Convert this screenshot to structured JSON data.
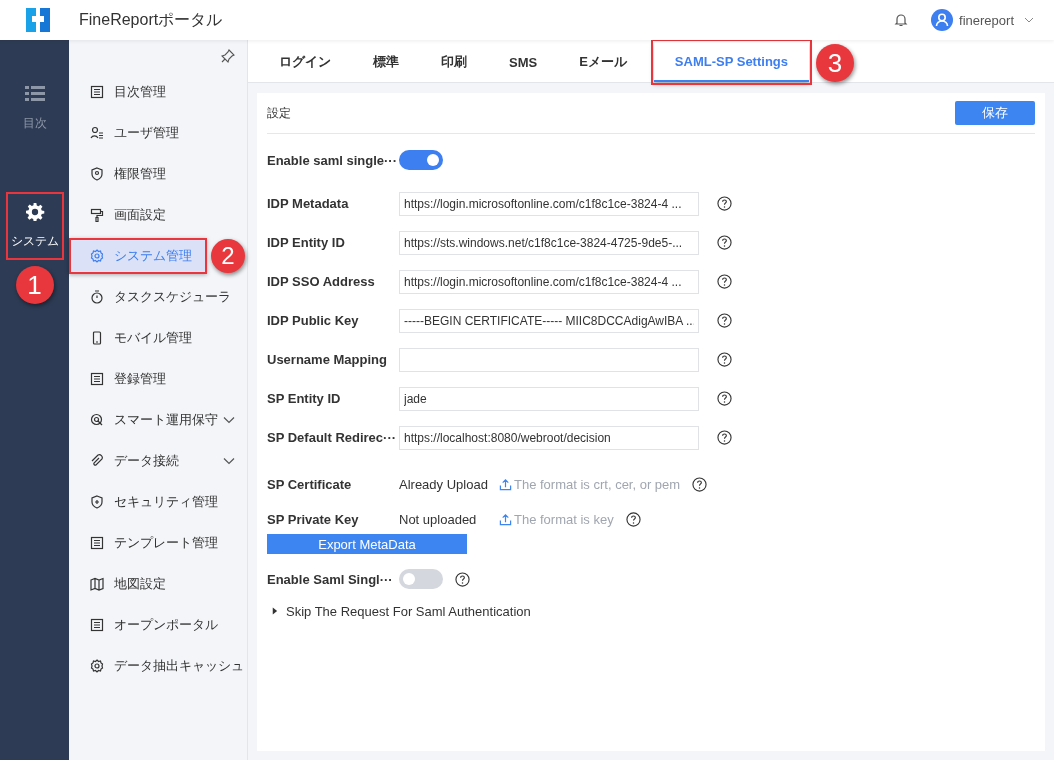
{
  "header": {
    "title": "FineReportポータル",
    "user": "finereport"
  },
  "rail": [
    {
      "label": "目次",
      "selected": false,
      "highlighted": false
    },
    {
      "label": "システム",
      "selected": true,
      "highlighted": true,
      "callout": "1"
    }
  ],
  "menu": [
    {
      "label": "目次管理",
      "selected": false,
      "expandable": false,
      "highlighted": false
    },
    {
      "label": "ユーザ管理",
      "selected": false,
      "expandable": false,
      "highlighted": false
    },
    {
      "label": "権限管理",
      "selected": false,
      "expandable": false,
      "highlighted": false
    },
    {
      "label": "画面設定",
      "selected": false,
      "expandable": false,
      "highlighted": false
    },
    {
      "label": "システム管理",
      "selected": true,
      "expandable": false,
      "highlighted": true,
      "callout": "2"
    },
    {
      "label": "タスクスケジューラ",
      "selected": false,
      "expandable": false,
      "highlighted": false
    },
    {
      "label": "モバイル管理",
      "selected": false,
      "expandable": false,
      "highlighted": false
    },
    {
      "label": "登録管理",
      "selected": false,
      "expandable": false,
      "highlighted": false
    },
    {
      "label": "スマート運用保守",
      "selected": false,
      "expandable": true,
      "highlighted": false
    },
    {
      "label": "データ接続",
      "selected": false,
      "expandable": true,
      "highlighted": false
    },
    {
      "label": "セキュリティ管理",
      "selected": false,
      "expandable": false,
      "highlighted": false
    },
    {
      "label": "テンプレート管理",
      "selected": false,
      "expandable": false,
      "highlighted": false
    },
    {
      "label": "地図設定",
      "selected": false,
      "expandable": false,
      "highlighted": false
    },
    {
      "label": "オープンポータル",
      "selected": false,
      "expandable": false,
      "highlighted": false
    },
    {
      "label": "データ抽出キャッシュ",
      "selected": false,
      "expandable": false,
      "highlighted": false
    }
  ],
  "tabs": [
    {
      "label": "ログイン",
      "selected": false,
      "highlighted": false
    },
    {
      "label": "標準",
      "selected": false,
      "highlighted": false
    },
    {
      "label": "印刷",
      "selected": false,
      "highlighted": false
    },
    {
      "label": "SMS",
      "selected": false,
      "highlighted": false
    },
    {
      "label": "Eメール",
      "selected": false,
      "highlighted": false
    },
    {
      "label": "SAML-SP Settings",
      "selected": true,
      "highlighted": true,
      "callout": "3"
    }
  ],
  "panel": {
    "title": "設定",
    "save_button": "保存",
    "rows": [
      {
        "kind": "toggle",
        "label": "Enable saml single···",
        "on": true,
        "help": false
      },
      {
        "kind": "input",
        "label": "IDP Metadata",
        "value": "https://login.microsoftonline.com/c1f8c1ce-3824-4 ..."
      },
      {
        "kind": "input",
        "label": "IDP Entity ID",
        "value": "https://sts.windows.net/c1f8c1ce-3824-4725-9de5-..."
      },
      {
        "kind": "input",
        "label": "IDP SSO Address",
        "value": "https://login.microsoftonline.com/c1f8c1ce-3824-4 ..."
      },
      {
        "kind": "input",
        "label": "IDP Public Key",
        "value": "-----BEGIN CERTIFICATE----- MIIC8DCCAdigAwIBA ..."
      },
      {
        "kind": "input",
        "label": "Username Mapping"
      },
      {
        "kind": "input",
        "label": "SP Entity ID",
        "value": "jade"
      },
      {
        "kind": "input",
        "label": "SP Default Redirec···",
        "value": "https://localhost:8080/webroot/decision"
      },
      {
        "kind": "upload",
        "label": "SP Certificate",
        "status": "Already Upload",
        "hint": "The format is crt, cer, or pem"
      },
      {
        "kind": "upload",
        "label": "SP Private Key",
        "status": "Not uploaded",
        "hint": "The format is key"
      },
      {
        "kind": "button",
        "label": "Export MetaData"
      },
      {
        "kind": "toggle",
        "label": "Enable Saml Singl···",
        "on": false,
        "help": true
      },
      {
        "kind": "expander",
        "label": "Skip The Request For Saml Authentication",
        "expanded": false
      }
    ]
  }
}
